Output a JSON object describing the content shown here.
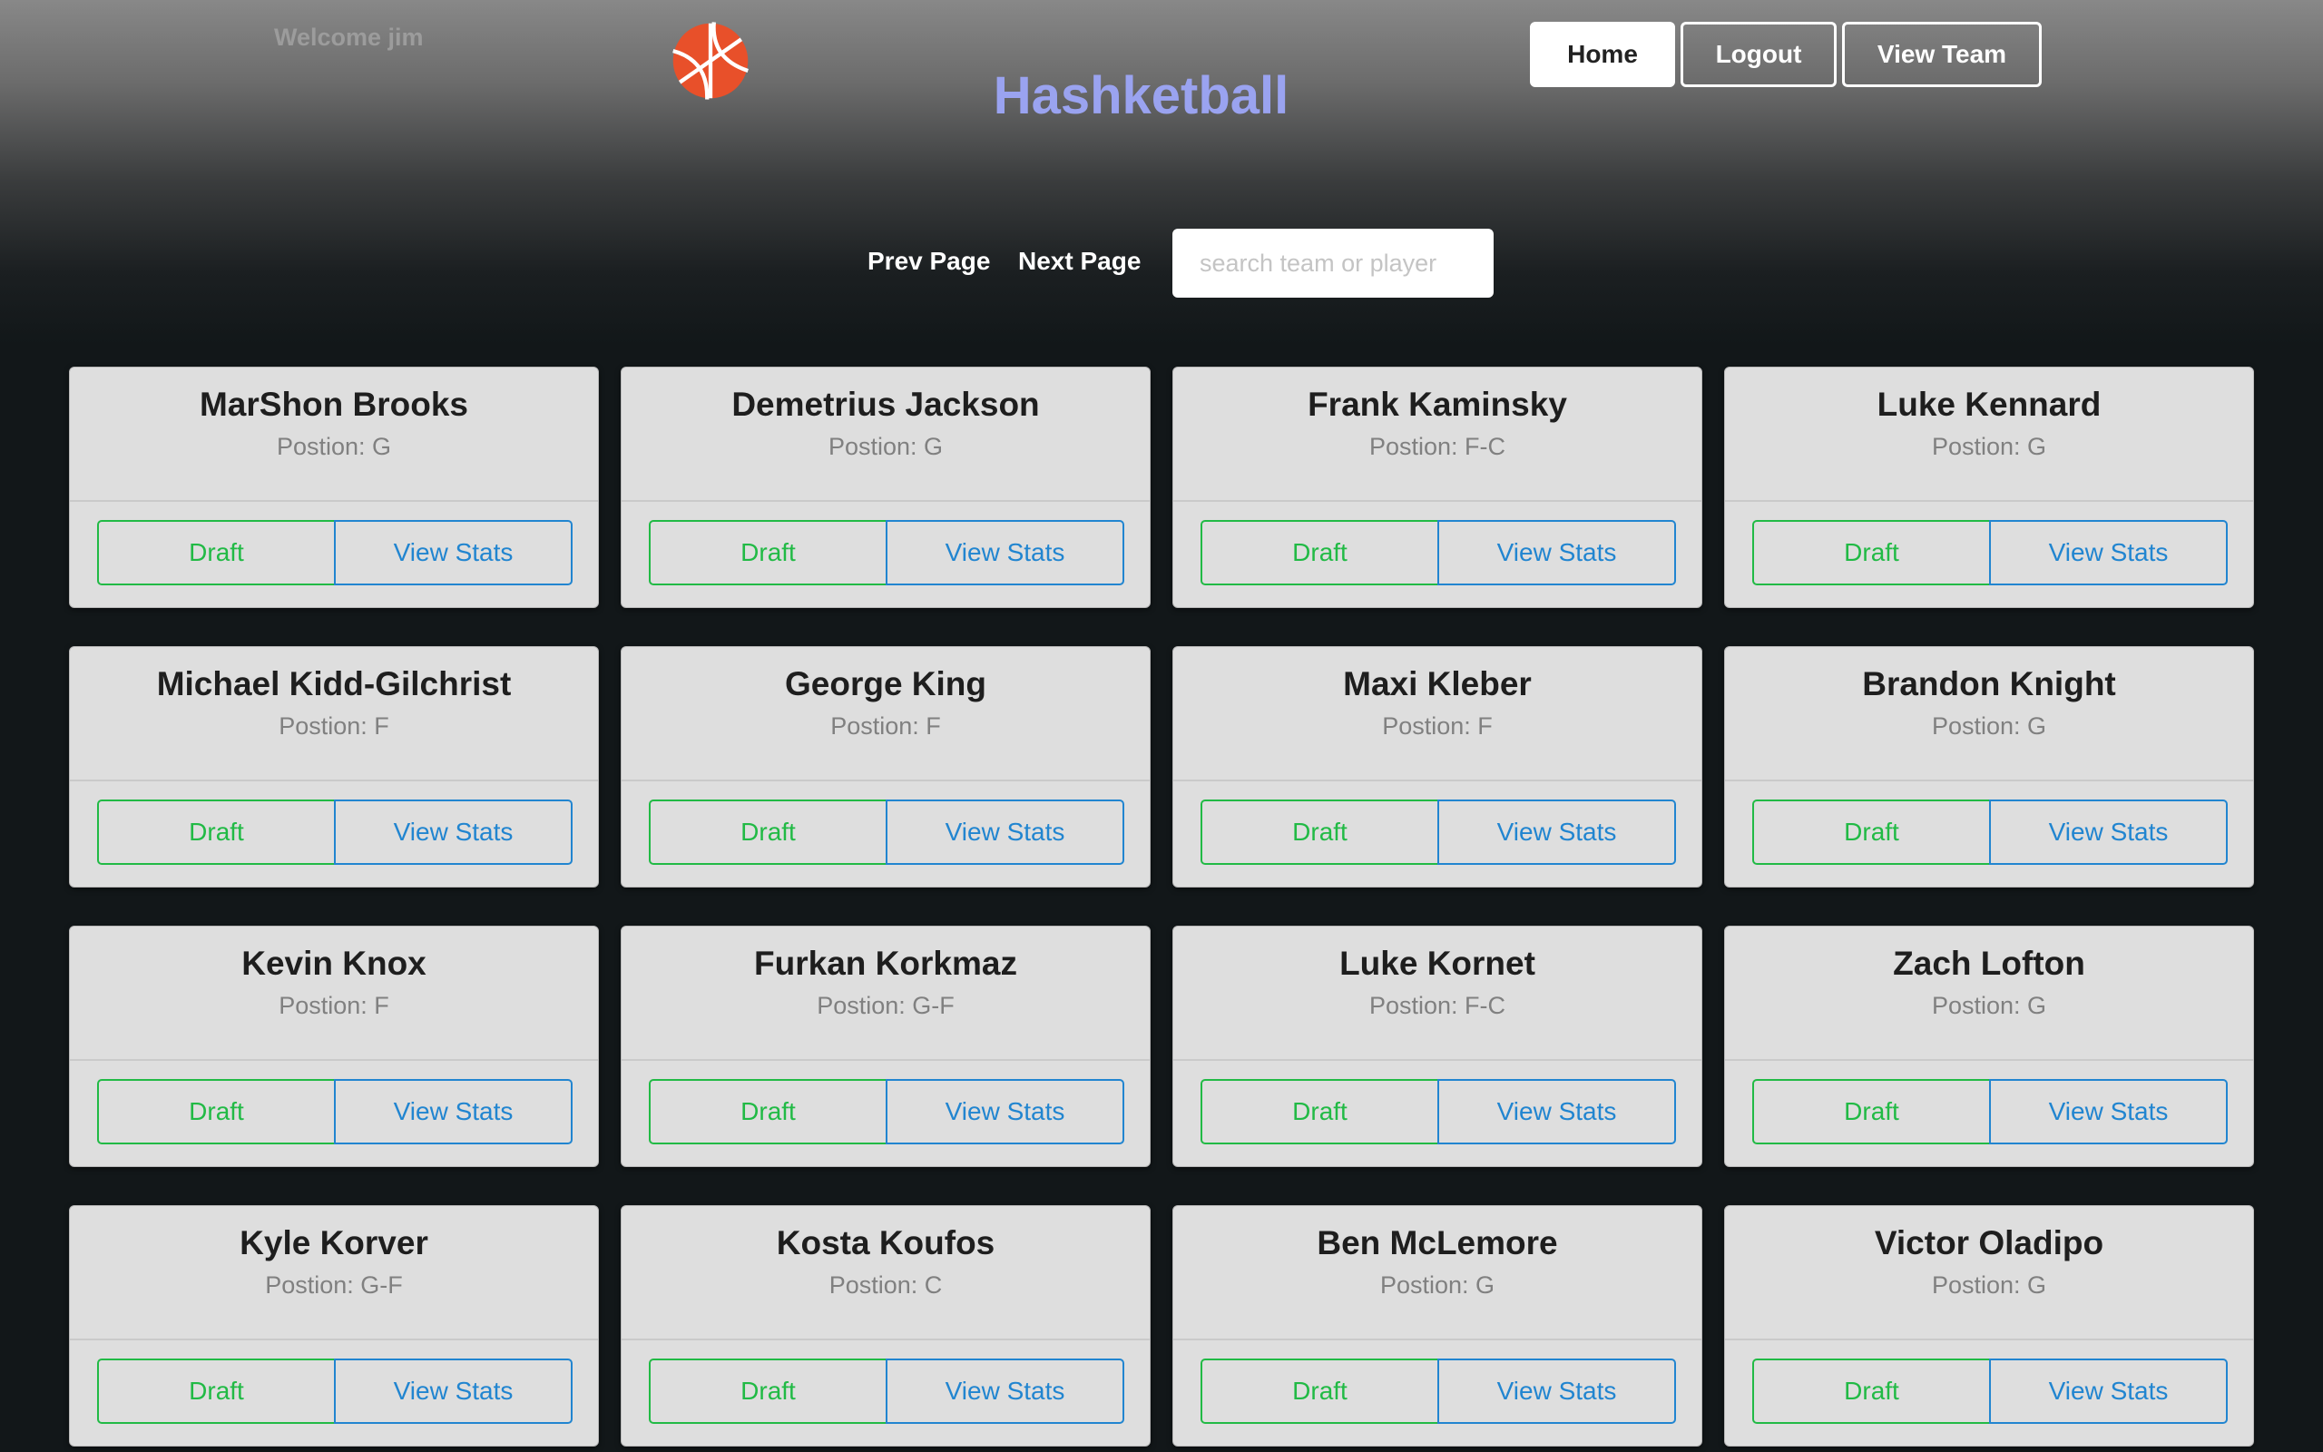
{
  "header": {
    "welcome": "Welcome jim",
    "title": "Hashketball",
    "logo_icon": "basketball-icon",
    "nav": [
      {
        "label": "Home",
        "active": true
      },
      {
        "label": "Logout",
        "active": false
      },
      {
        "label": "View Team",
        "active": false
      }
    ]
  },
  "pagination": {
    "prev_label": "Prev Page",
    "next_label": "Next Page"
  },
  "search": {
    "placeholder": "search team or player",
    "value": ""
  },
  "colors": {
    "title": "#9aa3f0",
    "draft": "#21ba45",
    "stats": "#2185d0",
    "logo": "#e8502a",
    "background": "#121719",
    "card": "#dedede"
  },
  "players": [
    {
      "name": "MarShon Brooks",
      "position": "Postion: G",
      "draft_label": "Draft",
      "stats_label": "View Stats"
    },
    {
      "name": "Demetrius Jackson",
      "position": "Postion: G",
      "draft_label": "Draft",
      "stats_label": "View Stats"
    },
    {
      "name": "Frank Kaminsky",
      "position": "Postion: F-C",
      "draft_label": "Draft",
      "stats_label": "View Stats"
    },
    {
      "name": "Luke Kennard",
      "position": "Postion: G",
      "draft_label": "Draft",
      "stats_label": "View Stats"
    },
    {
      "name": "Michael Kidd-Gilchrist",
      "position": "Postion: F",
      "draft_label": "Draft",
      "stats_label": "View Stats"
    },
    {
      "name": "George King",
      "position": "Postion: F",
      "draft_label": "Draft",
      "stats_label": "View Stats"
    },
    {
      "name": "Maxi Kleber",
      "position": "Postion: F",
      "draft_label": "Draft",
      "stats_label": "View Stats"
    },
    {
      "name": "Brandon Knight",
      "position": "Postion: G",
      "draft_label": "Draft",
      "stats_label": "View Stats"
    },
    {
      "name": "Kevin Knox",
      "position": "Postion: F",
      "draft_label": "Draft",
      "stats_label": "View Stats"
    },
    {
      "name": "Furkan Korkmaz",
      "position": "Postion: G-F",
      "draft_label": "Draft",
      "stats_label": "View Stats"
    },
    {
      "name": "Luke Kornet",
      "position": "Postion: F-C",
      "draft_label": "Draft",
      "stats_label": "View Stats"
    },
    {
      "name": "Zach Lofton",
      "position": "Postion: G",
      "draft_label": "Draft",
      "stats_label": "View Stats"
    },
    {
      "name": "Kyle Korver",
      "position": "Postion: G-F",
      "draft_label": "Draft",
      "stats_label": "View Stats"
    },
    {
      "name": "Kosta Koufos",
      "position": "Postion: C",
      "draft_label": "Draft",
      "stats_label": "View Stats"
    },
    {
      "name": "Ben McLemore",
      "position": "Postion: G",
      "draft_label": "Draft",
      "stats_label": "View Stats"
    },
    {
      "name": "Victor Oladipo",
      "position": "Postion: G",
      "draft_label": "Draft",
      "stats_label": "View Stats"
    }
  ]
}
